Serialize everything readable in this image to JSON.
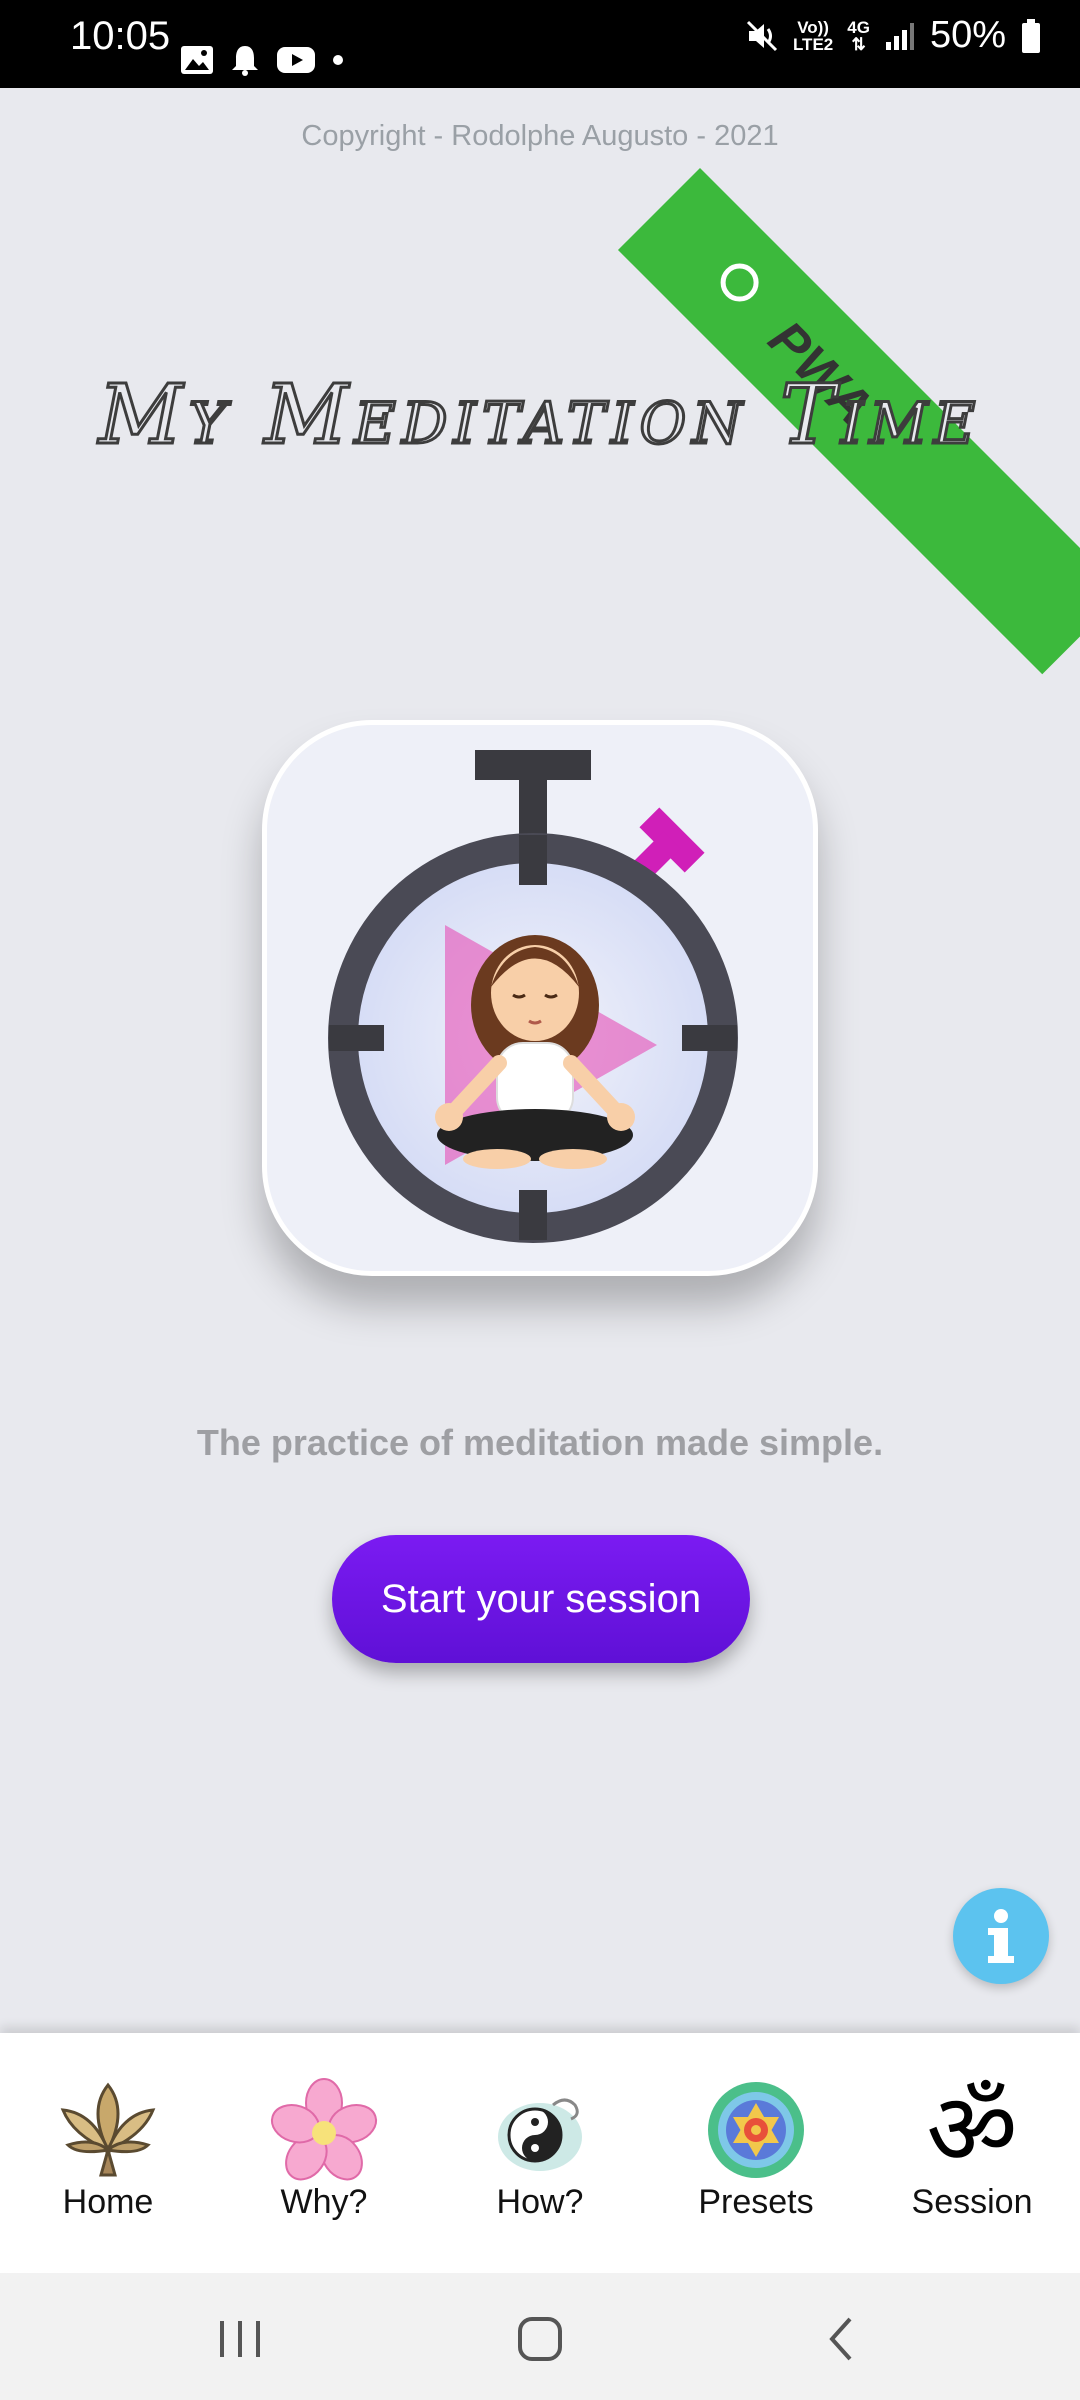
{
  "status_bar": {
    "time": "10:05",
    "network_top": "Vo))",
    "network_bottom": "LTE2",
    "network_gen": "4G",
    "battery": "50%",
    "icons": [
      "image-icon",
      "bell-icon",
      "youtube-icon",
      "dot-icon",
      "mute-icon",
      "signal-icon",
      "battery-icon"
    ]
  },
  "app": {
    "copyright": "Copyright - Rodolphe Augusto - 2021",
    "ribbon_text": "PWA",
    "title": "My Meditation Time",
    "tagline": "The practice of meditation made simple.",
    "start_button": "Start your session",
    "info_icon": "info-icon"
  },
  "nav": {
    "items": [
      {
        "label": "Home",
        "icon": "lotus-icon"
      },
      {
        "label": "Why?",
        "icon": "flower-icon"
      },
      {
        "label": "How?",
        "icon": "yin-yang-icon"
      },
      {
        "label": "Presets",
        "icon": "mandala-icon"
      },
      {
        "label": "Session",
        "icon": "om-icon"
      }
    ]
  },
  "colors": {
    "accent": "#6b14e6",
    "ribbon": "#3cb93c",
    "info": "#5cc3ef",
    "background": "#e8e9ee"
  }
}
